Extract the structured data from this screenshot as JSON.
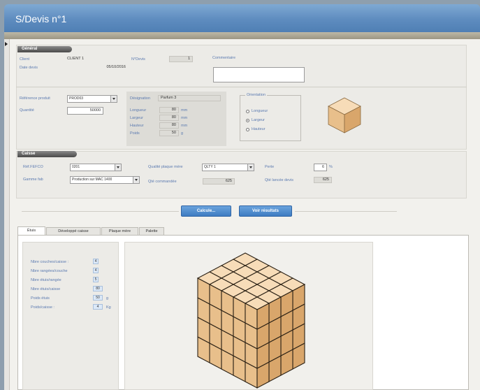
{
  "window": {
    "title": "S/Devis n°1"
  },
  "general": {
    "header": "Général",
    "client_label": "Client",
    "client_value": "CLIENT 1",
    "date_label": "Date devis",
    "date_value": "05/10/2016",
    "ndevis_label": "N°Devis",
    "ndevis_value": "1",
    "commentaire_label": "Commentaire",
    "commentaire_value": ""
  },
  "product": {
    "ref_label": "Référence produit",
    "ref_value": "PROD03",
    "qty_label": "Quantité",
    "qty_value": "50000",
    "designation_label": "Désignation",
    "designation_value": "Parfum 3",
    "longueur_label": "Longueur",
    "longueur_value": "80",
    "largeur_label": "Largeur",
    "largeur_value": "80",
    "hauteur_label": "Hauteur",
    "hauteur_value": "80",
    "poids_label": "Poids",
    "poids_value": "50",
    "unit_mm": "mm",
    "unit_g": "g",
    "orientation_title": "Orientation",
    "orientations": [
      {
        "label": "Longueur",
        "selected": false
      },
      {
        "label": "Largeur",
        "selected": true
      },
      {
        "label": "Hauteur",
        "selected": false
      }
    ]
  },
  "caisse": {
    "header": "Caisse",
    "ref_fefco_label": "Réf.FEFCO",
    "ref_fefco_value": "0201",
    "gamme_label": "Gamme fab",
    "gamme_value": "Production sur MAC 1400",
    "qualite_label": "Qualité plaque mère",
    "qualite_value": "QLTY 1",
    "qte_comm_label": "Qté commandée",
    "qte_comm_value": "625",
    "perte_label": "Perte",
    "perte_value": "6",
    "perte_unit": "%",
    "qte_lancee_label": "Qté lancée devis",
    "qte_lancee_value": "625"
  },
  "actions": {
    "calculate": "Calcule...",
    "voir": "Voir résultats"
  },
  "tabs": [
    {
      "label": "Étuis",
      "active": true
    },
    {
      "label": "Développé caisse",
      "active": false
    },
    {
      "label": "Plaque mère",
      "active": false
    },
    {
      "label": "Palette",
      "active": false
    }
  ],
  "etuis": {
    "rows": [
      {
        "label": "Nbre couches/caisse :",
        "value": "4",
        "unit": ""
      },
      {
        "label": "Nbre rangées/couche",
        "value": "4",
        "unit": ""
      },
      {
        "label": "Nbre étuis/rangée",
        "value": "5",
        "unit": ""
      },
      {
        "label": "Nbre étuis/caisse",
        "value": "80",
        "unit": ""
      },
      {
        "label": "Poids étuis",
        "value": "50",
        "unit": "g"
      },
      {
        "label": "Poids/caisse :",
        "value": "4",
        "unit": "Kg"
      }
    ]
  },
  "colors": {
    "accent": "#3e7cc2",
    "box_top": "#f7dcb8",
    "box_left": "#e8bf8b",
    "box_right": "#d9a66b"
  }
}
